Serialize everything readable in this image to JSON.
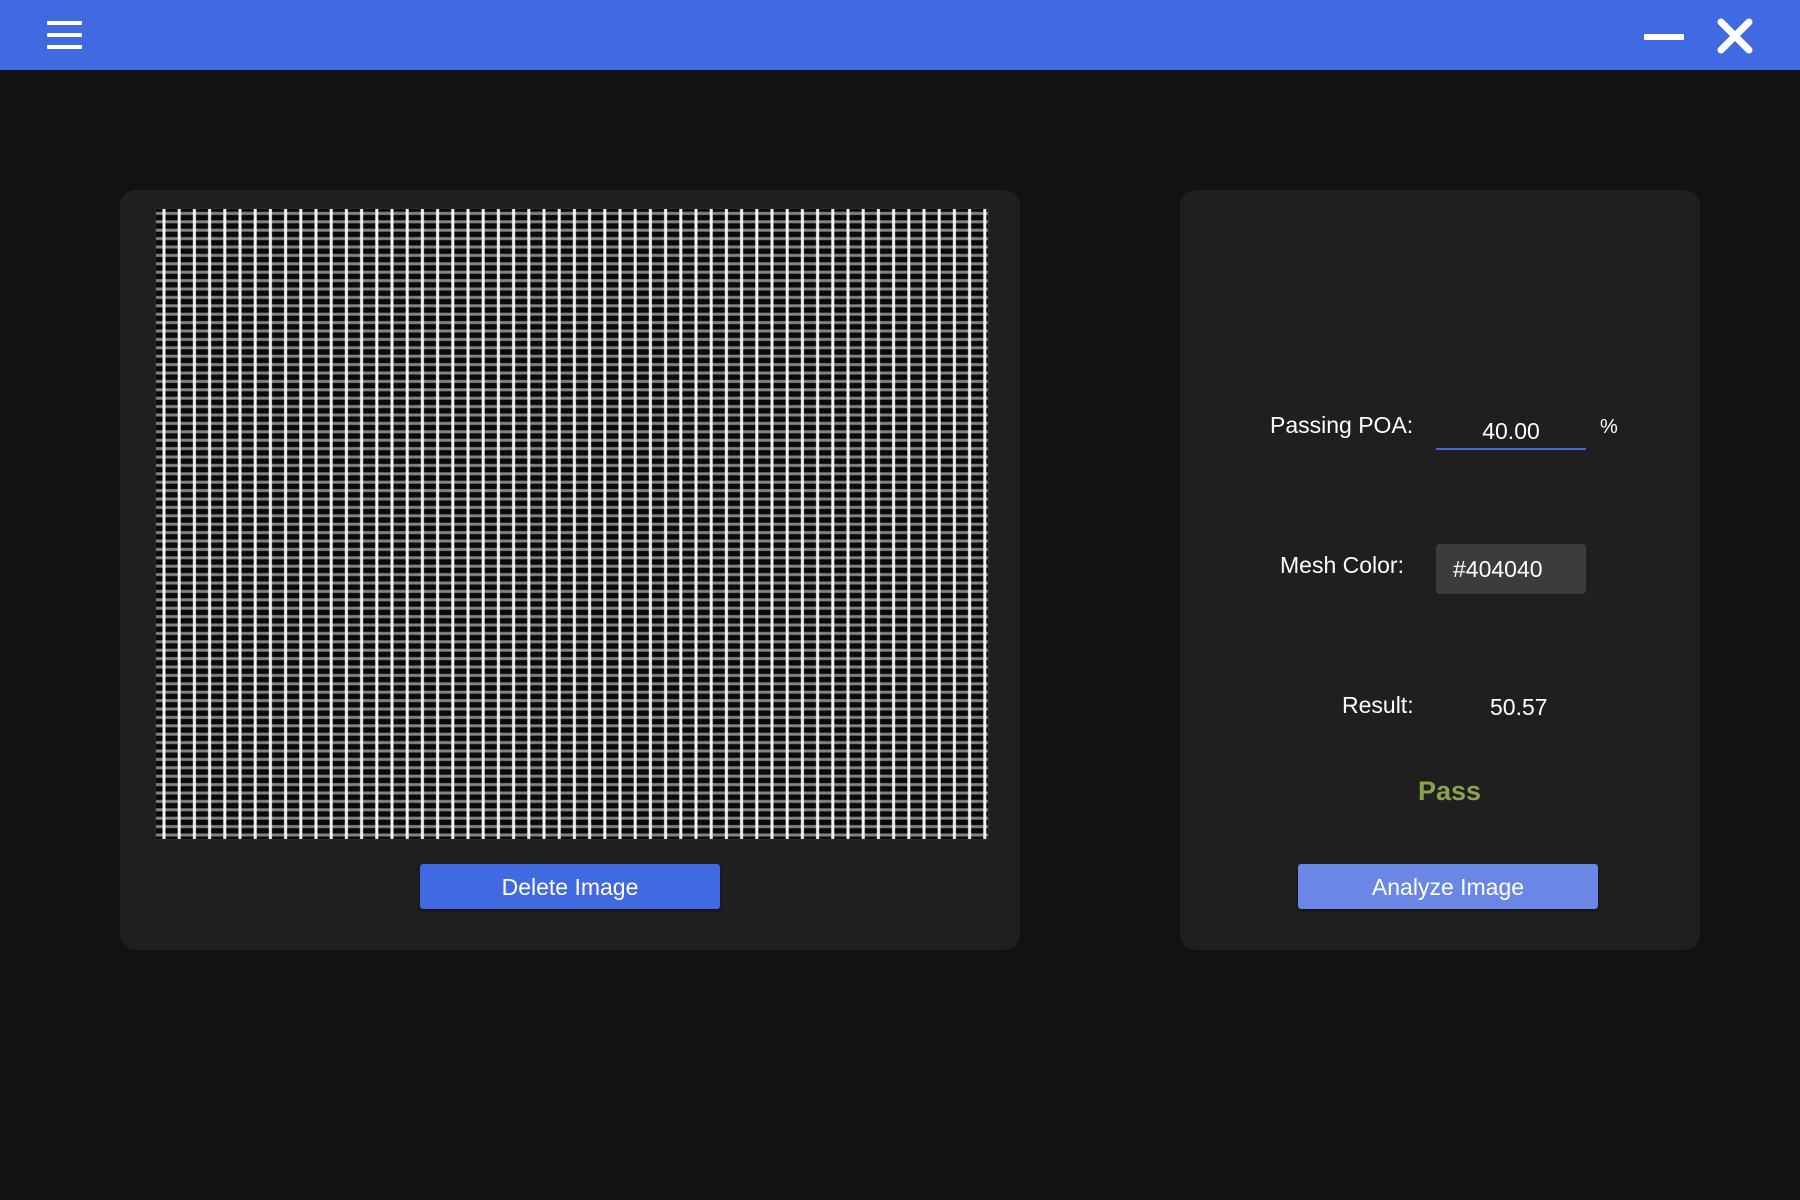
{
  "window": {
    "menu_icon": "hamburger-menu-icon",
    "minimize_icon": "minimize-icon",
    "close_icon": "close-icon",
    "accent_color": "#4169e1"
  },
  "left_panel": {
    "image_alt": "mesh-grid-image",
    "delete_button_label": "Delete Image"
  },
  "right_panel": {
    "poa_label": "Passing POA:",
    "poa_value": "40.00",
    "poa_unit": "%",
    "mesh_color_label": "Mesh Color:",
    "mesh_color_value": "#404040",
    "result_label": "Result:",
    "result_value": "50.57",
    "status_text": "Pass",
    "status_color": "#8aa34f",
    "analyze_button_label": "Analyze Image"
  }
}
